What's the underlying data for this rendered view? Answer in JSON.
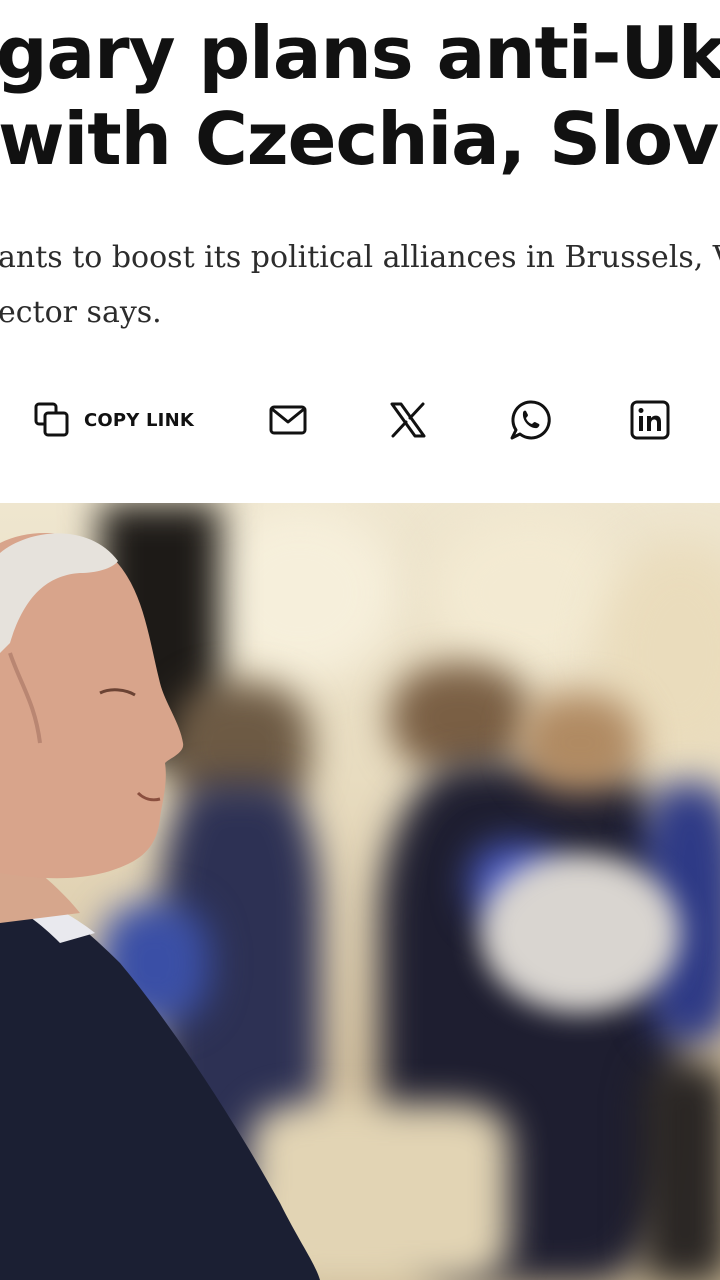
{
  "article": {
    "headline_line1": "gary plans anti-Ukra",
    "headline_line2": "with Czechia, Slova",
    "dek_line1": "ants to boost its political alliances in Brussels, Vik",
    "dek_line2": "ector says."
  },
  "share": {
    "copy_link_label": "COPY LINK",
    "icons": [
      "copy-icon",
      "email-icon",
      "x-icon",
      "whatsapp-icon",
      "linkedin-icon"
    ]
  },
  "colors": {
    "text": "#111111",
    "dek_text": "#2c2c2c",
    "background": "#ffffff"
  }
}
